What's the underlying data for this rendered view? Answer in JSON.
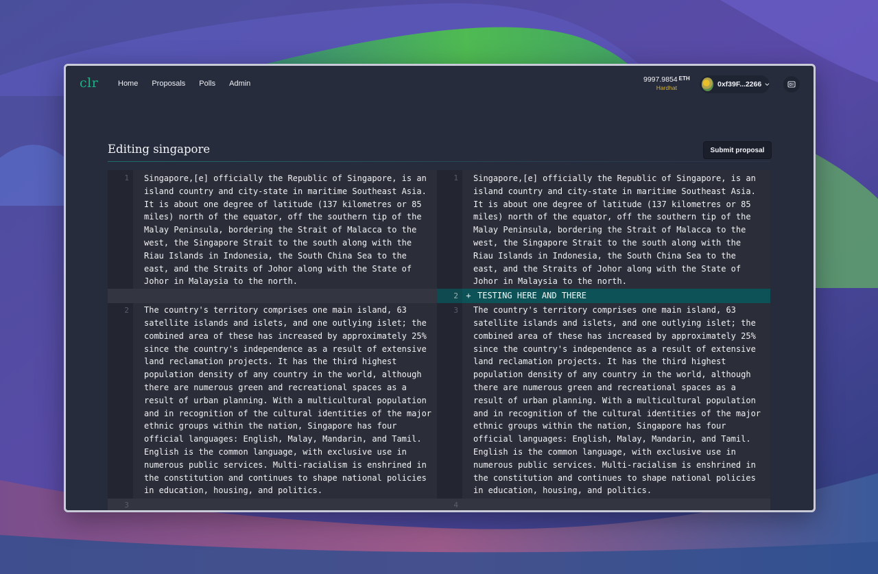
{
  "app": {
    "logo": "clr"
  },
  "nav": {
    "items": [
      {
        "label": "Home"
      },
      {
        "label": "Proposals"
      },
      {
        "label": "Polls"
      },
      {
        "label": "Admin"
      }
    ]
  },
  "wallet": {
    "balance": "9997.9854",
    "unit": "ETH",
    "network": "Hardhat",
    "address": "0xf39F...2266",
    "icon": "chevron-down-icon",
    "settings_icon": "screen-icon"
  },
  "page": {
    "title": "Editing singapore",
    "submit_label": "Submit proposal"
  },
  "diff": {
    "left": {
      "blocks": [
        {
          "line": "1",
          "text": "Singapore,[e] officially the Republic of Singapore, is an\nisland country and city-state in maritime Southeast Asia.\nIt is about one degree of latitude (137 kilometres or 85\nmiles) north of the equator, off the southern tip of the\nMalay Peninsula, bordering the Strait of Malacca to the\nwest, the Singapore Strait to the south along with the\nRiau Islands in Indonesia, the South China Sea to the\neast, and the Straits of Johor along with the State of\nJohor in Malaysia to the north."
        },
        {
          "line": "2",
          "text": "The country's territory comprises one main island, 63\nsatellite islands and islets, and one outlying islet; the\ncombined area of these has increased by approximately 25%\nsince the country's independence as a result of extensive\nland reclamation projects. It has the third highest\npopulation density of any country in the world, although\nthere are numerous green and recreational spaces as a\nresult of urban planning. With a multicultural population\nand in recognition of the cultural identities of the major\nethnic groups within the nation, Singapore has four\nofficial languages: English, Malay, Mandarin, and Tamil.\nEnglish is the common language, with exclusive use in\nnumerous public services. Multi-racialism is enshrined in\nthe constitution and continues to shape national policies\nin education, housing, and politics."
        },
        {
          "line": "3",
          "text": ""
        }
      ]
    },
    "right": {
      "blocks": [
        {
          "line": "1",
          "text": "Singapore,[e] officially the Republic of Singapore, is an\nisland country and city-state in maritime Southeast Asia.\nIt is about one degree of latitude (137 kilometres or 85\nmiles) north of the equator, off the southern tip of the\nMalay Peninsula, bordering the Strait of Malacca to the\nwest, the Singapore Strait to the south along with the\nRiau Islands in Indonesia, the South China Sea to the\neast, and the Straits of Johor along with the State of\nJohor in Malaysia to the north."
        },
        {
          "line": "2",
          "marker": "+",
          "text": "TESTING HERE AND THERE"
        },
        {
          "line": "3",
          "text": "The country's territory comprises one main island, 63\nsatellite islands and islets, and one outlying islet; the\ncombined area of these has increased by approximately 25%\nsince the country's independence as a result of extensive\nland reclamation projects. It has the third highest\npopulation density of any country in the world, although\nthere are numerous green and recreational spaces as a\nresult of urban planning. With a multicultural population\nand in recognition of the cultural identities of the major\nethnic groups within the nation, Singapore has four\nofficial languages: English, Malay, Mandarin, and Tamil.\nEnglish is the common language, with exclusive use in\nnumerous public services. Multi-racialism is enshrined in\nthe constitution and continues to shape national policies\nin education, housing, and politics."
        },
        {
          "line": "4",
          "text": ""
        }
      ]
    }
  },
  "colors": {
    "accent": "#1bb386",
    "added_row": "#0d5257",
    "network": "#d4b23a"
  }
}
